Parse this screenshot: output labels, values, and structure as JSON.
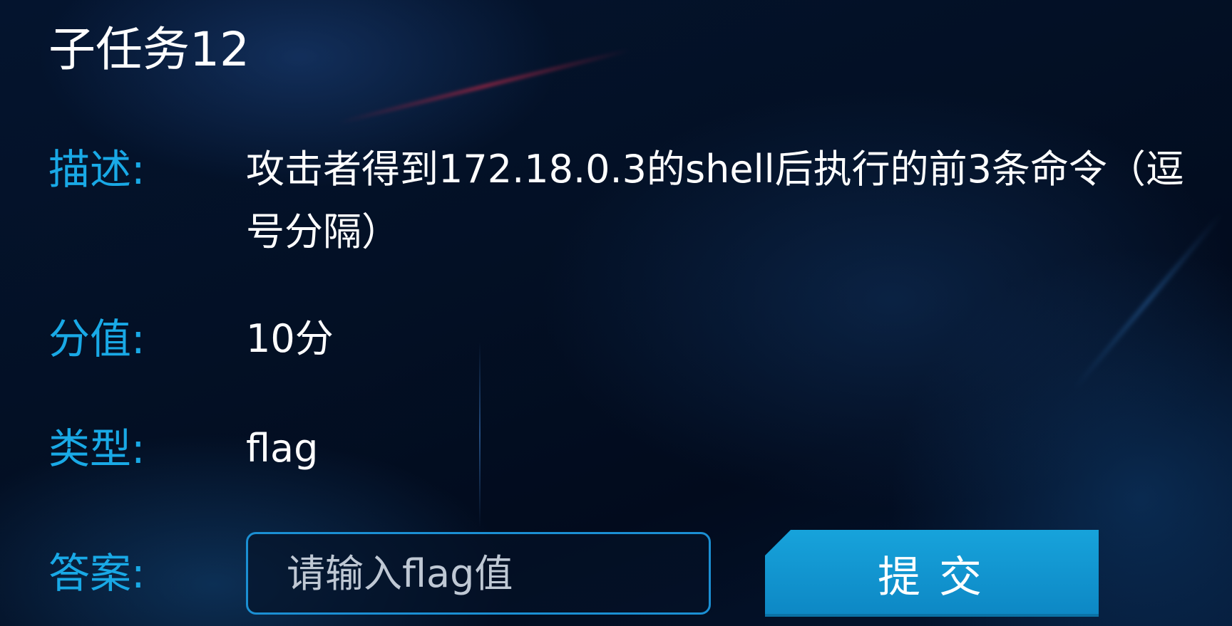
{
  "task": {
    "title": "子任务12"
  },
  "fields": {
    "description": {
      "label": "描述:",
      "value": "攻击者得到172.18.0.3的shell后执行的前3条命令（逗号分隔）"
    },
    "score": {
      "label": "分值:",
      "value": "10分"
    },
    "type": {
      "label": "类型:",
      "value": "flag"
    },
    "answer": {
      "label": "答案:",
      "placeholder": "请输入flag值",
      "value": ""
    }
  },
  "submit": {
    "label": "提交"
  },
  "colors": {
    "label_accent": "#19a9e6",
    "button_bg": "#0d87c4",
    "input_border": "#1b8fd3",
    "background": "#031025"
  }
}
